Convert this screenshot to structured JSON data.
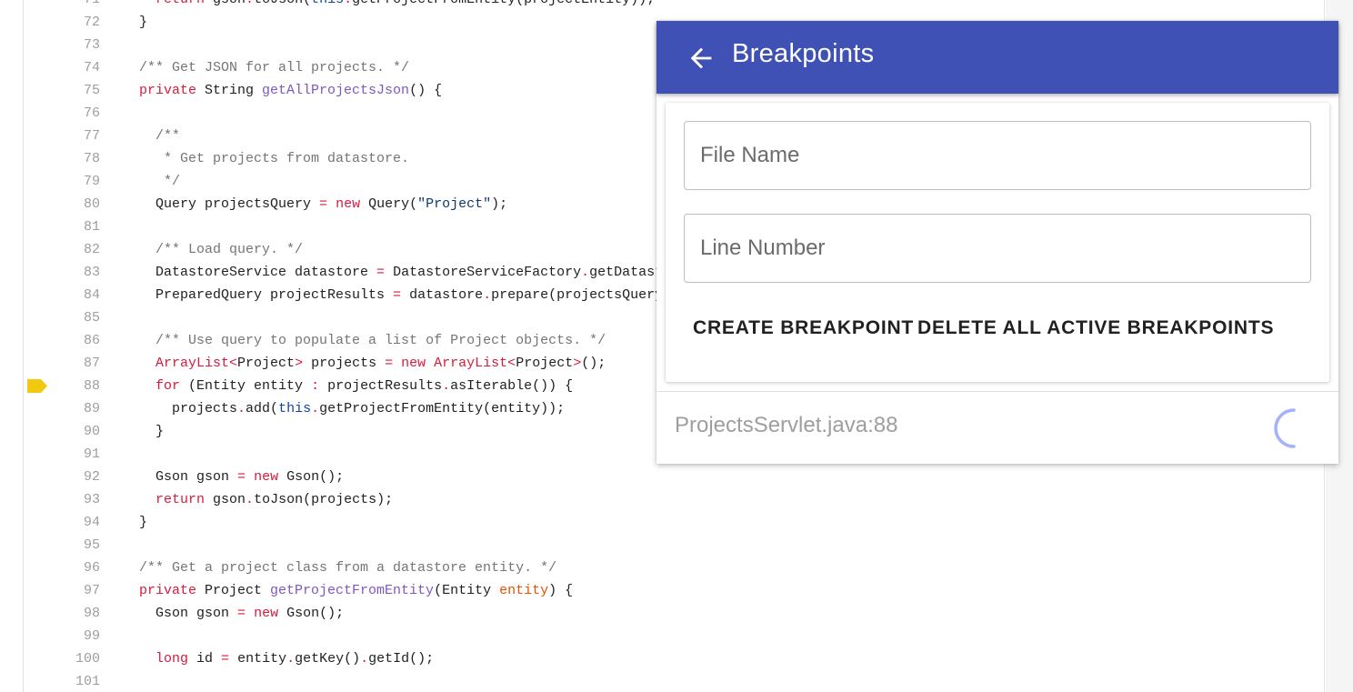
{
  "editor": {
    "lines": [
      {
        "num": "71",
        "html": "  <span class='t-kw'>return</span> gson<span class='t-op'>.</span>toJson(<span class='t-this'>this</span><span class='t-op'>.</span>getProjectFromEntity(projectEntity));"
      },
      {
        "num": "72",
        "html": "}"
      },
      {
        "num": "73",
        "html": ""
      },
      {
        "num": "74",
        "html": "<span class='t-cm'>/** Get JSON for all projects. */</span>"
      },
      {
        "num": "75",
        "html": "<span class='t-kw'>private</span> String <span class='t-fn'>getAllProjectsJson</span>() {"
      },
      {
        "num": "76",
        "html": ""
      },
      {
        "num": "77",
        "html": "  <span class='t-cm'>/**</span>"
      },
      {
        "num": "78",
        "html": "  <span class='t-cm'> * Get projects from datastore.</span>"
      },
      {
        "num": "79",
        "html": "  <span class='t-cm'> */</span>"
      },
      {
        "num": "80",
        "html": "  Query projectsQuery <span class='t-op'>=</span> <span class='t-kw'>new</span> Query(<span class='t-str'>\"Project\"</span>);"
      },
      {
        "num": "81",
        "html": ""
      },
      {
        "num": "82",
        "html": "  <span class='t-cm'>/** Load query. */</span>"
      },
      {
        "num": "83",
        "html": "  DatastoreService datastore <span class='t-op'>=</span> DatastoreServiceFactory<span class='t-op'>.</span>getDatastoreService();"
      },
      {
        "num": "84",
        "html": "  PreparedQuery projectResults <span class='t-op'>=</span> datastore<span class='t-op'>.</span>prepare(projectsQuery);"
      },
      {
        "num": "85",
        "html": ""
      },
      {
        "num": "86",
        "html": "  <span class='t-cm'>/** Use query to populate a list of Project objects. */</span>"
      },
      {
        "num": "87",
        "html": "  <span class='t-cls'>ArrayList</span><span class='t-op'>&lt;</span>Project<span class='t-op'>&gt;</span> projects <span class='t-op'>=</span> <span class='t-kw'>new</span> <span class='t-cls'>ArrayList</span><span class='t-op'>&lt;</span>Project<span class='t-op'>&gt;</span>();"
      },
      {
        "num": "88",
        "html": "  <span class='t-kw'>for</span> (Entity entity <span class='t-op'>:</span> projectResults<span class='t-op'>.</span>asIterable()) {"
      },
      {
        "num": "89",
        "html": "    projects<span class='t-op'>.</span>add(<span class='t-this'>this</span><span class='t-op'>.</span>getProjectFromEntity(entity));"
      },
      {
        "num": "90",
        "html": "  }"
      },
      {
        "num": "91",
        "html": ""
      },
      {
        "num": "92",
        "html": "  Gson gson <span class='t-op'>=</span> <span class='t-kw'>new</span> Gson();"
      },
      {
        "num": "93",
        "html": "  <span class='t-kw'>return</span> gson<span class='t-op'>.</span>toJson(projects);"
      },
      {
        "num": "94",
        "html": "}"
      },
      {
        "num": "95",
        "html": ""
      },
      {
        "num": "96",
        "html": "<span class='t-cm'>/** Get a project class from a datastore entity. */</span>"
      },
      {
        "num": "97",
        "html": "<span class='t-kw'>private</span> Project <span class='t-fn'>getProjectFromEntity</span>(Entity <span class='t-par'>entity</span>) {"
      },
      {
        "num": "98",
        "html": "  Gson gson <span class='t-op'>=</span> <span class='t-kw'>new</span> Gson();"
      },
      {
        "num": "99",
        "html": ""
      },
      {
        "num": "100",
        "html": "  <span class='t-kw'>long</span> id <span class='t-op'>=</span> entity<span class='t-op'>.</span>getKey()<span class='t-op'>.</span>getId();"
      },
      {
        "num": "101",
        "html": ""
      }
    ],
    "breakpoint_line": "88"
  },
  "panel": {
    "title": "Breakpoints",
    "back_icon": "arrow-back-icon",
    "file_name_placeholder": "File Name",
    "line_number_placeholder": "Line Number",
    "create_label": "Create Breakpoint",
    "delete_all_label": "Delete All Active Breakpoints",
    "breakpoints": [
      {
        "label": "ProjectsServlet.java:88",
        "status_icon": "loading-spinner-icon"
      }
    ]
  },
  "colors": {
    "header": "#3f51b5",
    "breakpoint_marker": "#f2c811",
    "keyword": "#d81b3c",
    "function": "#7e57c2",
    "comment": "#757575"
  }
}
